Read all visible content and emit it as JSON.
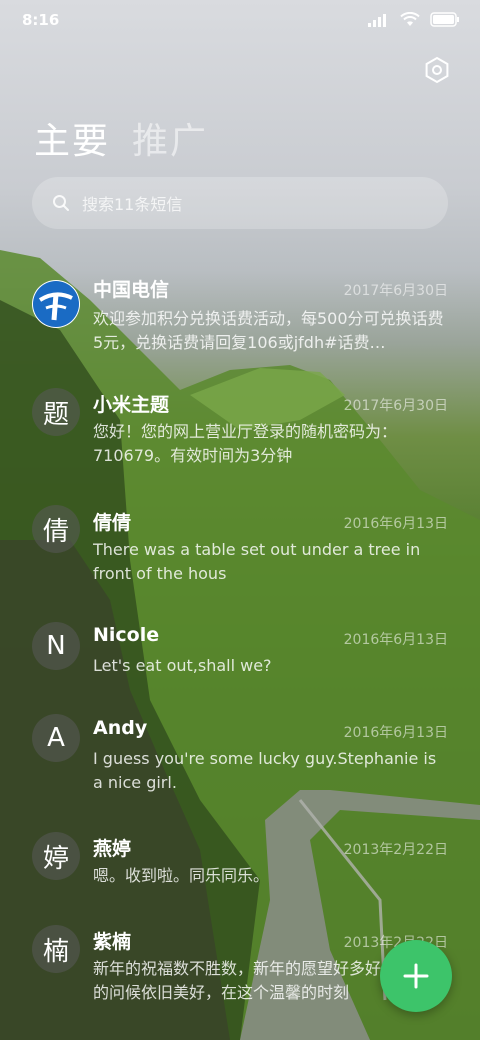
{
  "status": {
    "time": "8:16"
  },
  "tabs": [
    {
      "label": "主要"
    },
    {
      "label": "推广"
    }
  ],
  "search": {
    "placeholder": "搜索11条短信"
  },
  "messages": [
    {
      "sender": "中国电信",
      "date": "2017年6月30日",
      "preview": "欢迎参加积分兑换话费活动，每500分可兑换话费5元，兑换话费请回复106或jfdh#话费…",
      "avatar": "telecom-logo"
    },
    {
      "sender": "小米主题",
      "date": "2017年6月30日",
      "preview": "您好！您的网上营业厅登录的随机密码为：710679。有效时间为3分钟",
      "avatar": "题"
    },
    {
      "sender": "倩倩",
      "date": "2016年6月13日",
      "preview": "There was a table set out under a tree in front of the hous",
      "avatar": "倩"
    },
    {
      "sender": "Nicole",
      "date": "2016年6月13日",
      "preview": "Let's eat out,shall we?",
      "avatar": "N"
    },
    {
      "sender": "Andy",
      "date": "2016年6月13日",
      "preview": "I guess you're some lucky guy.Stephanie is a nice girl.",
      "avatar": "A"
    },
    {
      "sender": "燕婷",
      "date": "2013年2月22日",
      "preview": "嗯。收到啦。同乐同乐。",
      "avatar": "婷"
    },
    {
      "sender": "紫楠",
      "date": "2013年2月22日",
      "preview": "新年的祝福数不胜数，新年的愿望好多好多，新年的问候依旧美好，在这个温馨的时刻",
      "avatar": "楠"
    }
  ],
  "icons": {
    "settings": "settings-icon",
    "search": "search-icon",
    "compose": "plus-icon"
  },
  "colors": {
    "fab": "#3dc46a"
  }
}
